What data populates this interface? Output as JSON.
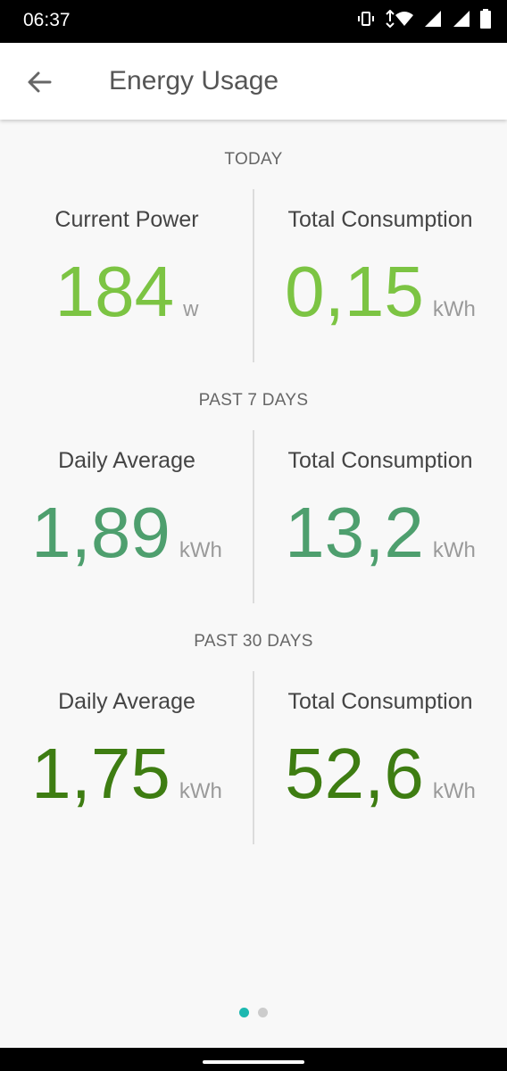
{
  "status_bar": {
    "time": "06:37",
    "icons": [
      "vibrate-icon",
      "wifi-icon",
      "signal-icon",
      "signal-icon",
      "battery-icon"
    ]
  },
  "app_bar": {
    "title": "Energy Usage",
    "back_icon": "arrow-left-icon"
  },
  "sections": [
    {
      "label": "TODAY",
      "color": "#7cc443",
      "left": {
        "label": "Current Power",
        "value": "184",
        "unit": "w"
      },
      "right": {
        "label": "Total Consumption",
        "value": "0,15",
        "unit": "kWh"
      }
    },
    {
      "label": "PAST 7 DAYS",
      "color": "#4e9f6e",
      "left": {
        "label": "Daily Average",
        "value": "1,89",
        "unit": "kWh"
      },
      "right": {
        "label": "Total Consumption",
        "value": "13,2",
        "unit": "kWh"
      }
    },
    {
      "label": "PAST 30 DAYS",
      "color": "#3e7d12",
      "left": {
        "label": "Daily Average",
        "value": "1,75",
        "unit": "kWh"
      },
      "right": {
        "label": "Total Consumption",
        "value": "52,6",
        "unit": "kWh"
      }
    }
  ],
  "pager": {
    "pages": 2,
    "active": 1,
    "active_color": "#1cb8b0",
    "inactive_color": "#cccccc"
  }
}
